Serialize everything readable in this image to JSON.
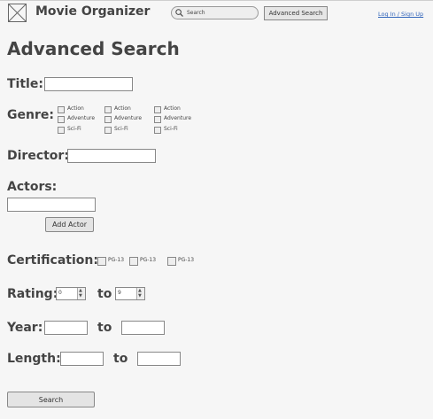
{
  "header": {
    "app_title": "Movie Organizer",
    "search_placeholder": "Search",
    "advanced_search_label": "Advanced Search",
    "login_label": "Log In / Sign Up"
  },
  "page": {
    "title": "Advanced Search"
  },
  "form": {
    "title_label": "Title:",
    "genre_label": "Genre:",
    "genre_options": [
      "Action",
      "Adventure",
      "Sci-Fi"
    ],
    "director_label": "Director:",
    "actors_label": "Actors:",
    "add_actor_label": "Add Actor",
    "certification_label": "Certification:",
    "certification_options": [
      "PG-13",
      "PG-13",
      "PG-13"
    ],
    "rating_label": "Rating:",
    "rating_from": "0",
    "rating_to": "9",
    "to_label": "to",
    "year_label": "Year:",
    "length_label": "Length:",
    "search_button_label": "Search"
  }
}
